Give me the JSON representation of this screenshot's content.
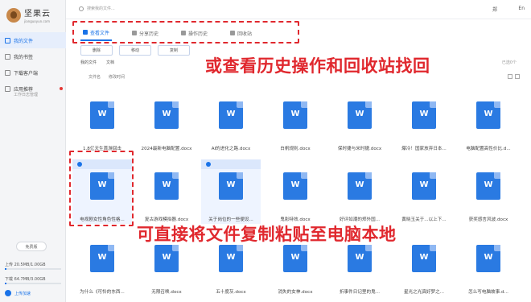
{
  "app": {
    "logo_text": "坚果云",
    "logo_sub": "jianguoyun.com"
  },
  "sidebar": {
    "items": [
      {
        "label": "我的文件",
        "active": true
      },
      {
        "label": "我的书签",
        "active": false
      },
      {
        "label": "下载客户端",
        "active": false
      },
      {
        "label": "应用推荐",
        "active": false,
        "sub": "工作日志管理",
        "badge": true
      }
    ],
    "free_label": "免费版",
    "upload_stat": "上传 20.5MB/1.00GB",
    "download_stat": "下载 64.7MB/3.00GB",
    "upload_label": "上传加速"
  },
  "topbar": {
    "search_placeholder": "搜索我的文件...",
    "user": "郑",
    "lang": "En"
  },
  "tabs": [
    {
      "label": "查看文件",
      "active": true
    },
    {
      "label": "分享历史",
      "active": false
    },
    {
      "label": "操作历史",
      "active": false
    },
    {
      "label": "回收站",
      "active": false
    }
  ],
  "actions": [
    "删除",
    "移动",
    "复制"
  ],
  "breadcrumb": [
    "我的文件",
    "文档"
  ],
  "sort": [
    "文件名",
    "修改时间"
  ],
  "count": "已选0个",
  "files": [
    {
      "name": "1.8亿天生首游回击"
    },
    {
      "name": "2024最新电脑配置.docx"
    },
    {
      "name": "AI的进化之路.docx"
    },
    {
      "name": "白帆规则.docx"
    },
    {
      "name": "保时捷与米时捷.docx"
    },
    {
      "name": "爆冷！国家放弃日本..."
    },
    {
      "name": "电脑配置高性价比.d..."
    },
    {
      "name": "电视剧女性角色性格...",
      "selected": true
    },
    {
      "name": "复古游戏模拟器.docx"
    },
    {
      "name": "关于岗位的一些便设...",
      "selected": true
    },
    {
      "name": "鬼影特效.docx"
    },
    {
      "name": "好评如潮的郑外国..."
    },
    {
      "name": "黄晓玉关于...以上下..."
    },
    {
      "name": "获奖感言风波.docx"
    },
    {
      "name": "为什么《可怜的东西..."
    },
    {
      "name": "无限召唤.docx"
    },
    {
      "name": "五十度灰.docx"
    },
    {
      "name": "消失的女神.docx"
    },
    {
      "name": "折事件日记里的鬼..."
    },
    {
      "name": "星光之光真好梦之..."
    },
    {
      "name": "怎么写电脑故事.d..."
    }
  ],
  "captions": {
    "top": "或查看历史操作和回收站找回",
    "bottom": "可直接将文件复制粘贴至电脑本地"
  }
}
